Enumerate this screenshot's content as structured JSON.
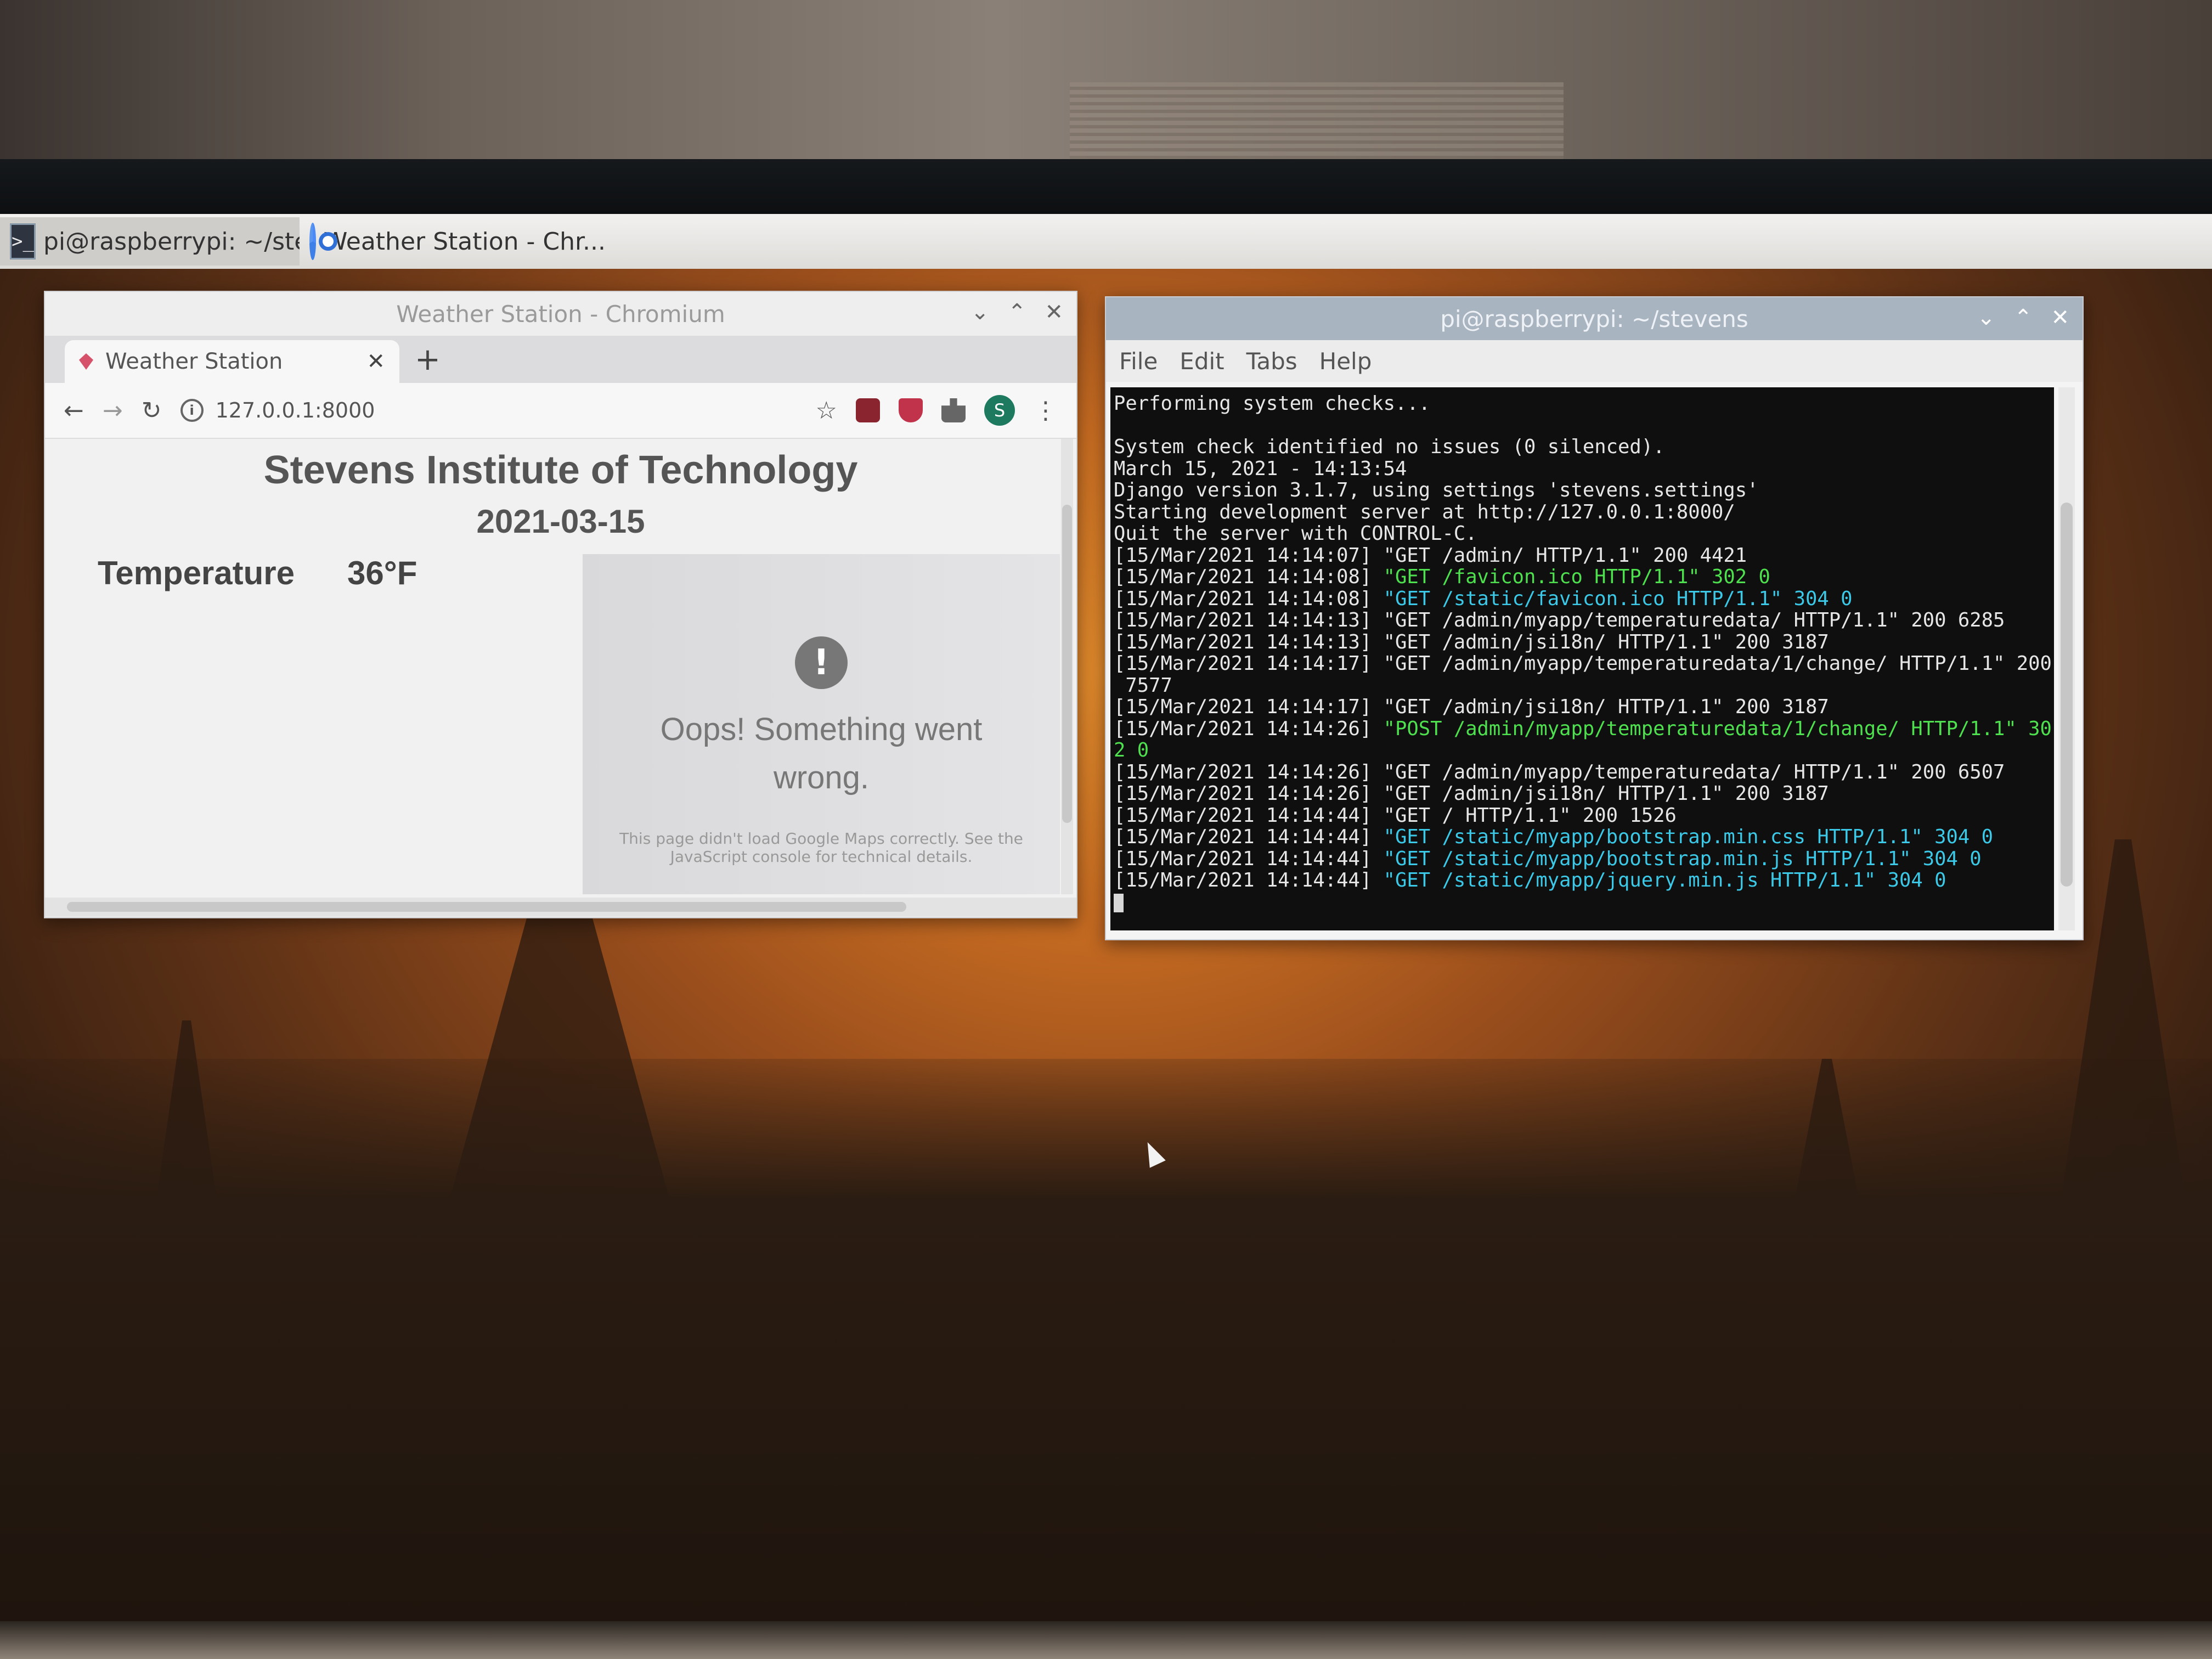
{
  "taskbar": {
    "items": [
      {
        "label": "pi@raspberrypi: ~/ste...",
        "icon": "terminal-icon"
      },
      {
        "label": "Weather Station - Chr...",
        "icon": "chromium-icon"
      }
    ]
  },
  "browser": {
    "window_title": "Weather Station - Chromium",
    "tab_title": "Weather Station",
    "url": "127.0.0.1:8000",
    "profile_initial": "S",
    "page": {
      "heading": "Stevens Institute of Technology",
      "date": "2021-03-15",
      "temperature_label": "Temperature",
      "temperature_value": "36°F",
      "map_error": {
        "title": "Oops! Something went wrong.",
        "detail": "This page didn't load Google Maps correctly. See the JavaScript console for technical details."
      }
    }
  },
  "terminal": {
    "window_title": "pi@raspberrypi: ~/stevens",
    "menu": [
      "File",
      "Edit",
      "Tabs",
      "Help"
    ],
    "lines": [
      {
        "parts": [
          {
            "t": "Performing system checks..."
          }
        ]
      },
      {
        "parts": [
          {
            "t": ""
          }
        ]
      },
      {
        "parts": [
          {
            "t": "System check identified no issues (0 silenced)."
          }
        ]
      },
      {
        "parts": [
          {
            "t": "March 15, 2021 - 14:13:54"
          }
        ]
      },
      {
        "parts": [
          {
            "t": "Django version 3.1.7, using settings 'stevens.settings'"
          }
        ]
      },
      {
        "parts": [
          {
            "t": "Starting development server at http://127.0.0.1:8000/"
          }
        ]
      },
      {
        "parts": [
          {
            "t": "Quit the server with CONTROL-C."
          }
        ]
      },
      {
        "parts": [
          {
            "t": "[15/Mar/2021 14:14:07] \"GET /admin/ HTTP/1.1\" 200 4421"
          }
        ]
      },
      {
        "parts": [
          {
            "t": "[15/Mar/2021 14:14:08] "
          },
          {
            "t": "\"GET /favicon.ico HTTP/1.1\" 302 0",
            "c": "g"
          }
        ]
      },
      {
        "parts": [
          {
            "t": "[15/Mar/2021 14:14:08] "
          },
          {
            "t": "\"GET /static/favicon.ico HTTP/1.1\" 304 0",
            "c": "c"
          }
        ]
      },
      {
        "parts": [
          {
            "t": "[15/Mar/2021 14:14:13] \"GET /admin/myapp/temperaturedata/ HTTP/1.1\" 200 6285"
          }
        ]
      },
      {
        "parts": [
          {
            "t": "[15/Mar/2021 14:14:13] \"GET /admin/jsi18n/ HTTP/1.1\" 200 3187"
          }
        ]
      },
      {
        "parts": [
          {
            "t": "[15/Mar/2021 14:14:17] \"GET /admin/myapp/temperaturedata/1/change/ HTTP/1.1\" 200"
          }
        ]
      },
      {
        "parts": [
          {
            "t": " 7577"
          }
        ]
      },
      {
        "parts": [
          {
            "t": "[15/Mar/2021 14:14:17] \"GET /admin/jsi18n/ HTTP/1.1\" 200 3187"
          }
        ]
      },
      {
        "parts": [
          {
            "t": "[15/Mar/2021 14:14:26] "
          },
          {
            "t": "\"POST /admin/myapp/temperaturedata/1/change/ HTTP/1.1\" 30",
            "c": "g"
          }
        ]
      },
      {
        "parts": [
          {
            "t": "2 0",
            "c": "g"
          }
        ]
      },
      {
        "parts": [
          {
            "t": "[15/Mar/2021 14:14:26] \"GET /admin/myapp/temperaturedata/ HTTP/1.1\" 200 6507"
          }
        ]
      },
      {
        "parts": [
          {
            "t": "[15/Mar/2021 14:14:26] \"GET /admin/jsi18n/ HTTP/1.1\" 200 3187"
          }
        ]
      },
      {
        "parts": [
          {
            "t": "[15/Mar/2021 14:14:44] \"GET / HTTP/1.1\" 200 1526"
          }
        ]
      },
      {
        "parts": [
          {
            "t": "[15/Mar/2021 14:14:44] "
          },
          {
            "t": "\"GET /static/myapp/bootstrap.min.css HTTP/1.1\" 304 0",
            "c": "c"
          }
        ]
      },
      {
        "parts": [
          {
            "t": "[15/Mar/2021 14:14:44] "
          },
          {
            "t": "\"GET /static/myapp/bootstrap.min.js HTTP/1.1\" 304 0",
            "c": "c"
          }
        ]
      },
      {
        "parts": [
          {
            "t": "[15/Mar/2021 14:14:44] "
          },
          {
            "t": "\"GET /static/myapp/jquery.min.js HTTP/1.1\" 304 0",
            "c": "c"
          }
        ]
      }
    ]
  }
}
